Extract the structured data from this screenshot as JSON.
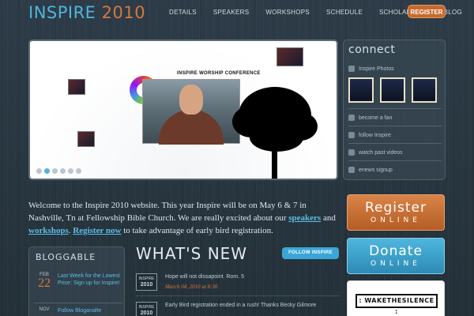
{
  "header": {
    "logo_main": "INSPIRE",
    "logo_year": "2010",
    "nav": [
      "DETAILS",
      "SPEAKERS",
      "WORKSHOPS",
      "SCHEDULE",
      "SCHOLARSHIP",
      "BLOG"
    ],
    "register_label": "REGISTER"
  },
  "slideshow": {
    "conference_title": "INSPIRE WORSHIP CONFERENCE",
    "slide_count": 6,
    "active_index": 1
  },
  "connect": {
    "title": "connect",
    "photos_label": "Inspire Photos",
    "items": [
      "become a fan",
      "follow Inspire",
      "watch past videos",
      "enews signup"
    ]
  },
  "welcome": {
    "part1": "Welcome to the Inspire 2010 website. This year Inspire will be on May 6 & 7 in Nashville, Tn at Fellowship Bible Church. We are really excited about our ",
    "link_speakers": "speakers",
    "part2": " and ",
    "link_workshops": "workshops",
    "part3": ". ",
    "link_register": "Register now",
    "part4": " to take advantage of early bird registration."
  },
  "promos": {
    "register_big": "Register",
    "register_small": "ONLINE",
    "donate_big": "Donate",
    "donate_small": "ONLINE",
    "wakethesilence": ": WAKETHESILENCE :"
  },
  "bloggable": {
    "title": "BLOGGABLE",
    "posts": [
      {
        "month": "FEB",
        "day": "22",
        "title": "Last Week for the Lowest Price: Sign up for Inspire!"
      },
      {
        "month": "NOV",
        "day": "",
        "title": "Follow Bloganalte"
      }
    ]
  },
  "whatsnew": {
    "title": "WHAT'S NEW",
    "follow_label": "FOLLOW INSPIRE",
    "items": [
      {
        "badge_top": "INSPIRE",
        "badge_year": "2010",
        "text": "Hope will not dissapoint. Rom. 5",
        "meta": "March 04, 2010 at 8:30"
      },
      {
        "badge_top": "INSPIRE",
        "badge_year": "2010",
        "text": "Early Bird registration ended in a rush! Thanks Becky Gilmore",
        "meta": ""
      }
    ]
  },
  "colors": {
    "accent_blue": "#4fb4dc",
    "accent_orange": "#d7783a",
    "background": "#2d3c48"
  }
}
